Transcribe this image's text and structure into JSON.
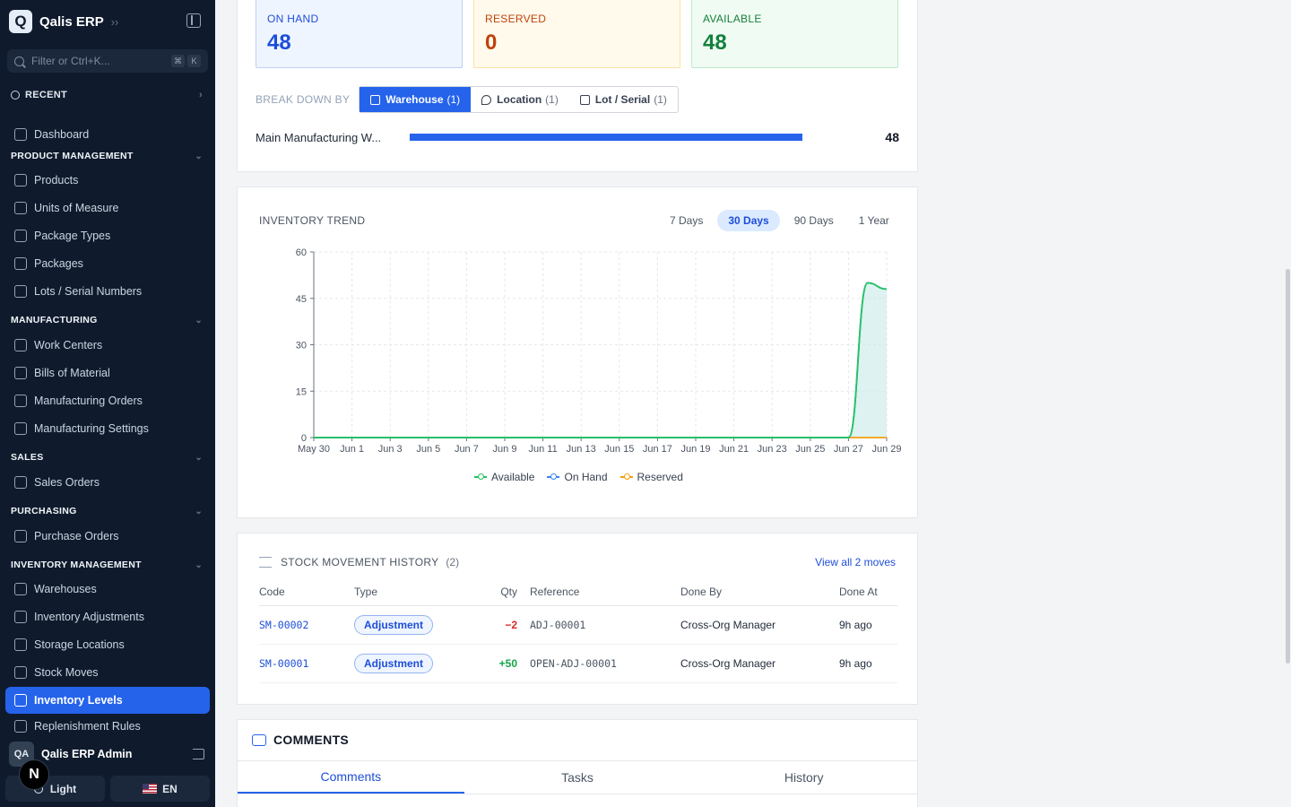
{
  "sidebar": {
    "app_name": "Qalis ERP",
    "logo_letter": "Q",
    "filter_placeholder": "Filter or Ctrl+K...",
    "kbd1": "⌘",
    "kbd2": "K",
    "recent": "RECENT",
    "dashboard": "Dashboard",
    "sections": {
      "product": "PRODUCT MANAGEMENT",
      "manufacturing": "MANUFACTURING",
      "sales": "SALES",
      "purchasing": "PURCHASING",
      "inventory": "INVENTORY MANAGEMENT"
    },
    "items": {
      "products": "Products",
      "uom": "Units of Measure",
      "package_types": "Package Types",
      "packages": "Packages",
      "lots": "Lots / Serial Numbers",
      "work_centers": "Work Centers",
      "bom": "Bills of Material",
      "mo": "Manufacturing Orders",
      "mfg_settings": "Manufacturing Settings",
      "sales_orders": "Sales Orders",
      "purchase_orders": "Purchase Orders",
      "warehouses": "Warehouses",
      "inv_adjustments": "Inventory Adjustments",
      "storage_locations": "Storage Locations",
      "stock_moves": "Stock Moves",
      "inventory_levels": "Inventory Levels",
      "replenishment": "Replenishment Rules"
    },
    "user_initials": "QA",
    "user_name": "Qalis ERP Admin",
    "n_badge": "N",
    "theme": "Light",
    "lang": "EN"
  },
  "stats": {
    "on_hand_label": "ON HAND",
    "on_hand": "48",
    "reserved_label": "RESERVED",
    "reserved": "0",
    "available_label": "AVAILABLE",
    "available": "48"
  },
  "breakdown": {
    "label": "BREAK DOWN BY",
    "warehouse": "Warehouse",
    "warehouse_count": "(1)",
    "location": "Location",
    "location_count": "(1)",
    "lot": "Lot / Serial",
    "lot_count": "(1)",
    "row_name": "Main Manufacturing W...",
    "row_qty": "48",
    "row_fraction": 1.0
  },
  "trend": {
    "title": "INVENTORY TREND",
    "ranges": [
      "7 Days",
      "30 Days",
      "90 Days",
      "1 Year"
    ],
    "selected_range": "30 Days"
  },
  "chart_data": {
    "type": "line",
    "ylim": [
      0,
      60
    ],
    "yticks": [
      0,
      15,
      30,
      45,
      60
    ],
    "x_labels": [
      "May 30",
      "Jun 1",
      "Jun 3",
      "Jun 5",
      "Jun 7",
      "Jun 9",
      "Jun 11",
      "Jun 13",
      "Jun 15",
      "Jun 17",
      "Jun 19",
      "Jun 21",
      "Jun 23",
      "Jun 25",
      "Jun 27",
      "Jun 29"
    ],
    "x": [
      "May 30",
      "May 31",
      "Jun 1",
      "Jun 2",
      "Jun 3",
      "Jun 4",
      "Jun 5",
      "Jun 6",
      "Jun 7",
      "Jun 8",
      "Jun 9",
      "Jun 10",
      "Jun 11",
      "Jun 12",
      "Jun 13",
      "Jun 14",
      "Jun 15",
      "Jun 16",
      "Jun 17",
      "Jun 18",
      "Jun 19",
      "Jun 20",
      "Jun 21",
      "Jun 22",
      "Jun 23",
      "Jun 24",
      "Jun 25",
      "Jun 26",
      "Jun 27",
      "Jun 28",
      "Jun 29"
    ],
    "series": [
      {
        "name": "Available",
        "color": "#22c55e",
        "values": [
          0,
          0,
          0,
          0,
          0,
          0,
          0,
          0,
          0,
          0,
          0,
          0,
          0,
          0,
          0,
          0,
          0,
          0,
          0,
          0,
          0,
          0,
          0,
          0,
          0,
          0,
          0,
          0,
          0,
          50,
          48
        ]
      },
      {
        "name": "On Hand",
        "color": "#3b82f6",
        "values": [
          0,
          0,
          0,
          0,
          0,
          0,
          0,
          0,
          0,
          0,
          0,
          0,
          0,
          0,
          0,
          0,
          0,
          0,
          0,
          0,
          0,
          0,
          0,
          0,
          0,
          0,
          0,
          0,
          0,
          50,
          48
        ]
      },
      {
        "name": "Reserved",
        "color": "#f59e0b",
        "values": [
          0,
          0,
          0,
          0,
          0,
          0,
          0,
          0,
          0,
          0,
          0,
          0,
          0,
          0,
          0,
          0,
          0,
          0,
          0,
          0,
          0,
          0,
          0,
          0,
          0,
          0,
          0,
          0,
          0,
          0,
          0
        ]
      }
    ],
    "legend": [
      "Available",
      "On Hand",
      "Reserved"
    ],
    "grid": true,
    "legend_position": "bottom"
  },
  "moves": {
    "title": "STOCK MOVEMENT HISTORY",
    "count": "(2)",
    "view_all": "View all 2 moves",
    "headers": [
      "Code",
      "Type",
      "Qty",
      "Reference",
      "Done By",
      "Done At"
    ],
    "rows": [
      {
        "code": "SM-00002",
        "type": "Adjustment",
        "qty": "−2",
        "ref": "ADJ-00001",
        "by": "Cross-Org Manager",
        "at": "9h ago"
      },
      {
        "code": "SM-00001",
        "type": "Adjustment",
        "qty": "+50",
        "ref": "OPEN-ADJ-00001",
        "by": "Cross-Org Manager",
        "at": "9h ago"
      }
    ]
  },
  "comments": {
    "title": "COMMENTS",
    "tabs": [
      "Comments",
      "Tasks",
      "History"
    ]
  }
}
